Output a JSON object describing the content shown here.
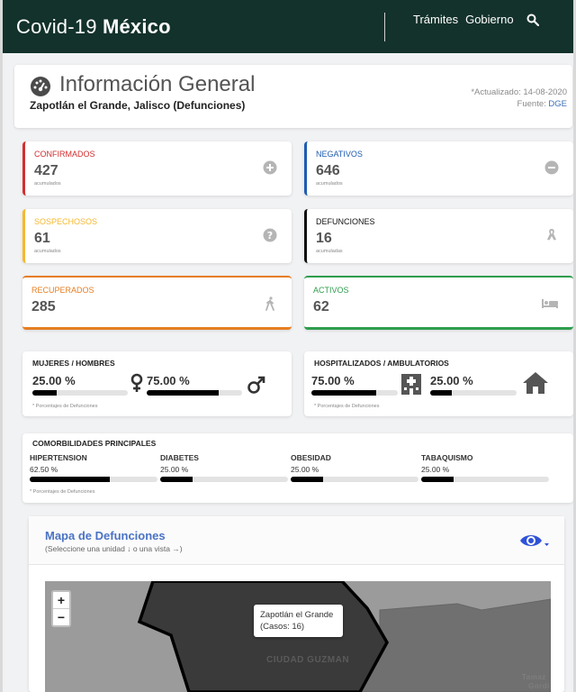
{
  "nav": {
    "brand_prefix": "Covid-19",
    "brand_suffix": "México",
    "links": [
      "Trámites",
      "Gobierno"
    ]
  },
  "header": {
    "title": "Información General",
    "subtitle": "Zapotlán el Grande, Jalisco (Defunciones)",
    "updated": "*Actualizado: 14-08-2020",
    "source_prefix": "Fuente:",
    "source": "DGE"
  },
  "stats": [
    {
      "label": "CONFIRMADOS",
      "value": "427",
      "note": "acumulados",
      "color": "#d32f2f",
      "icon": "plus-circle-icon"
    },
    {
      "label": "NEGATIVOS",
      "value": "646",
      "note": "acumulados",
      "color": "#1e5cb3",
      "icon": "minus-circle-icon"
    },
    {
      "label": "SOSPECHOSOS",
      "value": "61",
      "note": "acumulados",
      "color": "#f5b82e",
      "icon": "question-circle-icon"
    },
    {
      "label": "DEFUNCIONES",
      "value": "16",
      "note": "acumuladas",
      "color": "#111111",
      "icon": "ribbon-icon"
    },
    {
      "label": "RECUPERADOS",
      "value": "285",
      "note": "",
      "color": "#e67e22",
      "icon": "walking-icon"
    },
    {
      "label": "ACTIVOS",
      "value": "62",
      "note": "",
      "color": "#2e9d4d",
      "icon": "bed-icon"
    }
  ],
  "gender": {
    "heading": "MUJERES / HOMBRES",
    "female_pct": "25.00 %",
    "female_fill": 0.25,
    "male_pct": "75.00 %",
    "male_fill": 0.75,
    "footnote": "* Porcentajes de Defunciones"
  },
  "hospital": {
    "heading": "HOSPITALIZADOS / AMBULATORIOS",
    "hosp_pct": "75.00 %",
    "hosp_fill": 0.75,
    "amb_pct": "25.00 %",
    "amb_fill": 0.25,
    "footnote": "* Porcentajes de Defunciones"
  },
  "comorbidities": {
    "heading": "COMORBILIDADES PRINCIPALES",
    "items": [
      {
        "name": "HIPERTENSION",
        "value": "62.50 %",
        "fill": 0.625
      },
      {
        "name": "DIABETES",
        "value": "25.00 %",
        "fill": 0.25
      },
      {
        "name": "OBESIDAD",
        "value": "25.00 %",
        "fill": 0.25
      },
      {
        "name": "TABAQUISMO",
        "value": "25.00 %",
        "fill": 0.25
      }
    ],
    "footnote": "* Porcentajes de Defunciones"
  },
  "map": {
    "title": "Mapa de Defunciones",
    "subtitle": "(Seleccione una unidad ↓ o una vista →)",
    "zoom_in": "+",
    "zoom_out": "−",
    "tooltip_name": "Zapotlán el Grande",
    "tooltip_cases": "(Casos: 16)",
    "city_label": "CIUDAD GUZMAN",
    "corner_label_1": "Tamaz",
    "corner_label_2": "Gordi"
  }
}
